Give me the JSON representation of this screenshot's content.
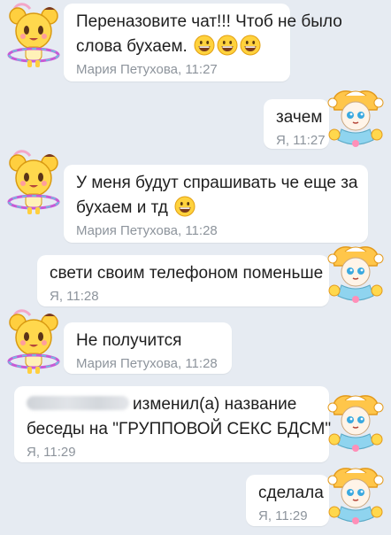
{
  "messages": [
    {
      "lines": [
        "Переназовите чат!!! Чтоб не было",
        "слова бухаем."
      ],
      "smiles": 3,
      "meta": "Мария Петухова, 11:27"
    },
    {
      "lines": [
        "зачем"
      ],
      "meta": "Я, 11:27"
    },
    {
      "lines": [
        "У меня будут спрашивать че еще за",
        "бухаем и тд"
      ],
      "smiles": 1,
      "meta": "Мария Петухова, 11:28"
    },
    {
      "lines": [
        "свети своим телефоном поменьше"
      ],
      "meta": "Я, 11:28"
    },
    {
      "lines": [
        "Не получится"
      ],
      "meta": "Мария Петухова, 11:28"
    },
    {
      "lines": [
        "изменил(а) название",
        "беседы на \"ГРУППОВОЙ СЕКС БДСМ\""
      ],
      "meta": "Я, 11:29"
    },
    {
      "lines": [
        "сделала"
      ],
      "meta": "Я, 11:29"
    }
  ],
  "icons": {
    "incoming_avatar": "cookie-character-avatar-icon",
    "outgoing_avatar": "jester-character-avatar-icon",
    "smile": "grinning-smiley-icon"
  },
  "colors": {
    "background": "#e6ebf2",
    "bubble": "#ffffff",
    "meta_text": "#8d949c",
    "message_text": "#1e1e1e"
  }
}
